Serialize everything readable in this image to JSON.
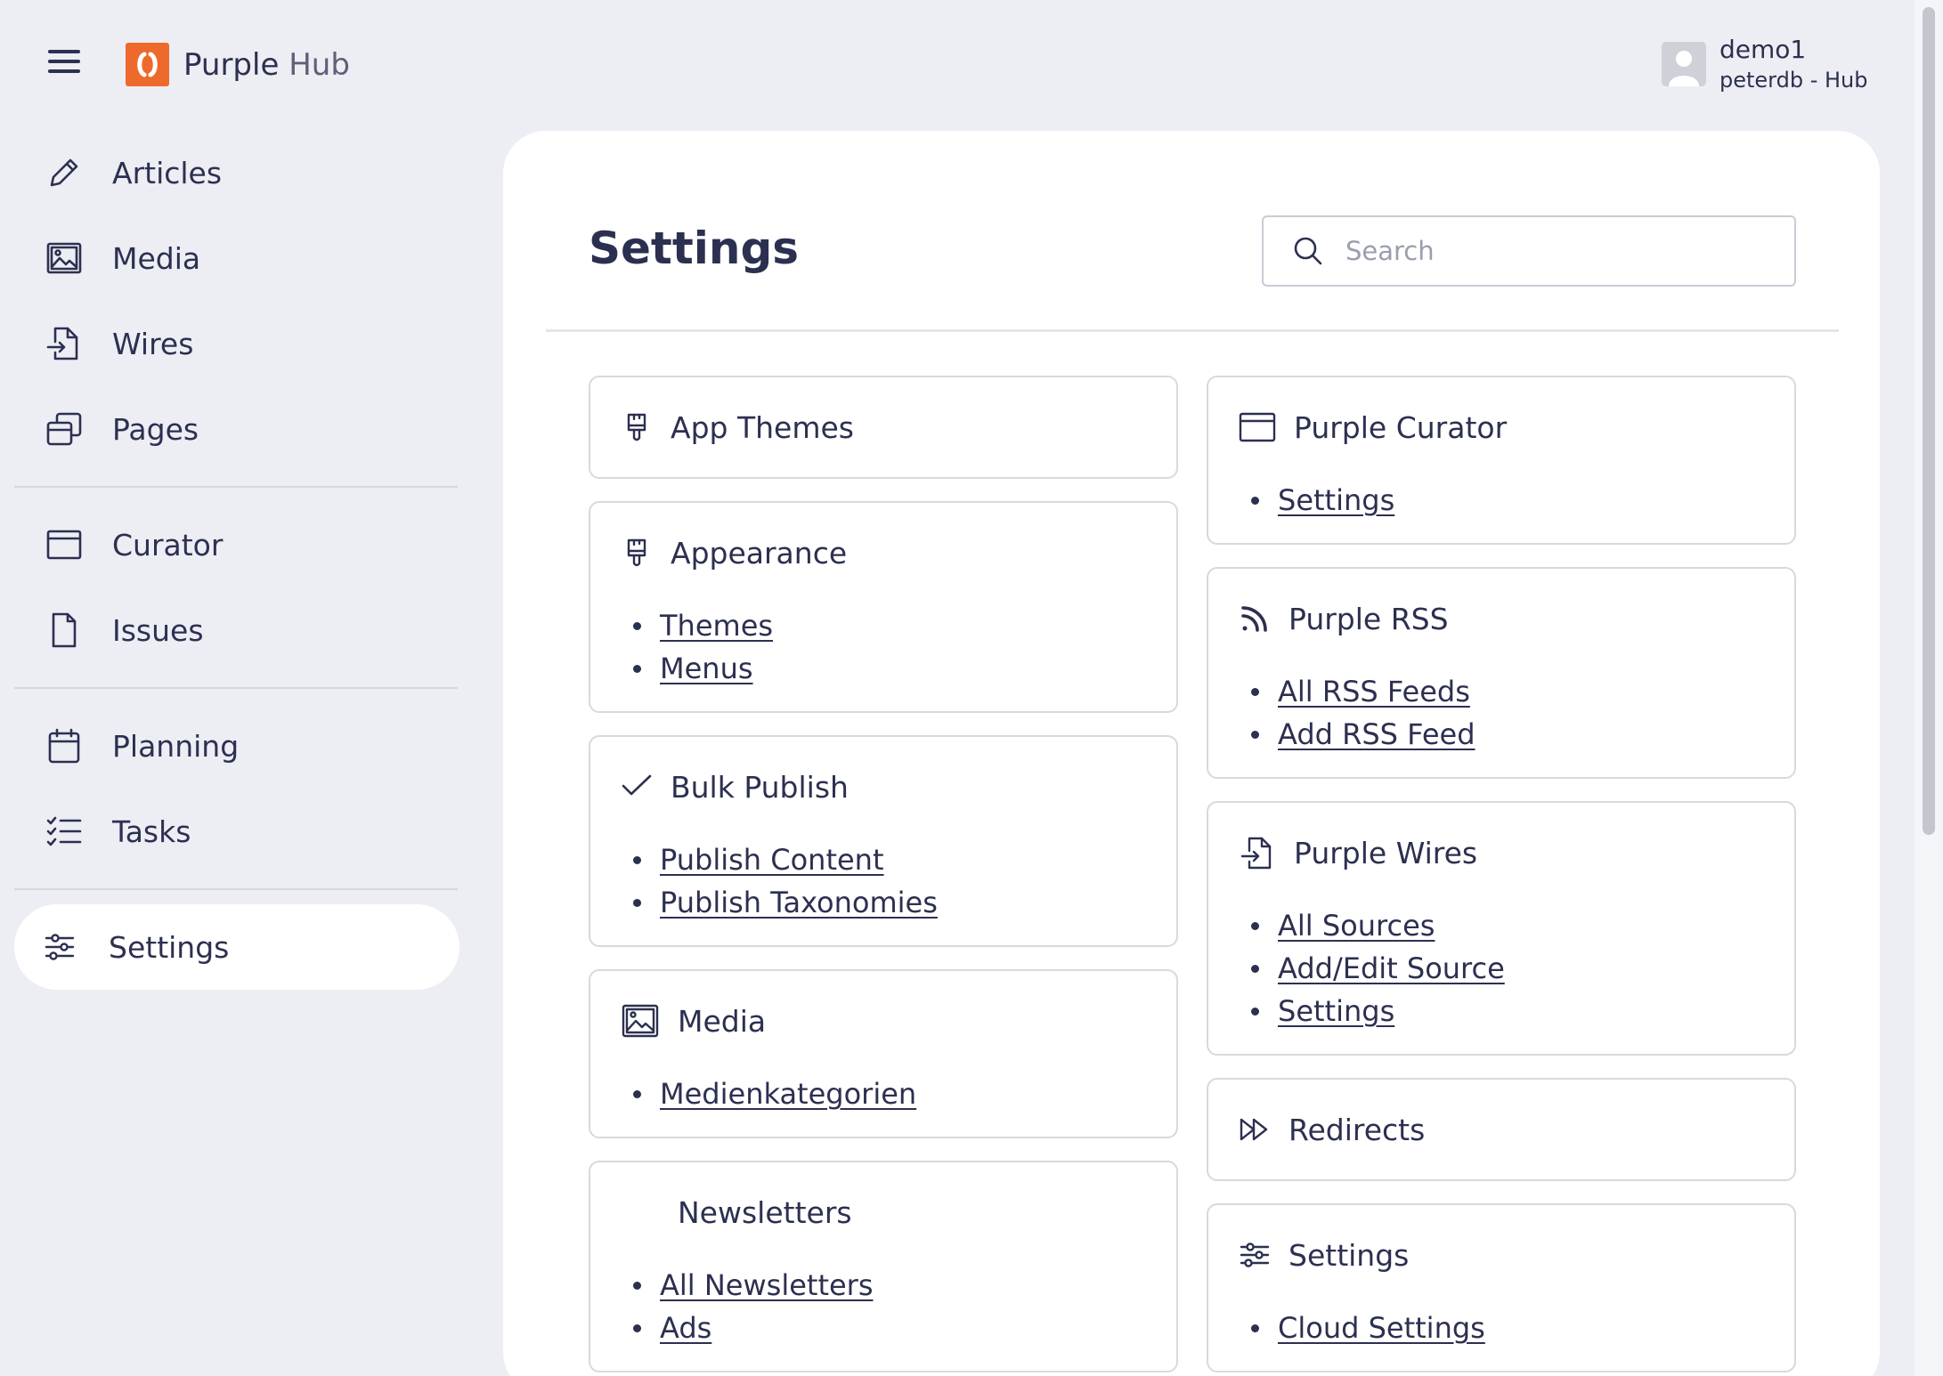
{
  "header": {
    "brand_main": "Purple",
    "brand_sub": "Hub",
    "user_name": "demo1",
    "user_sub": "peterdb - Hub"
  },
  "sidebar": {
    "group1": [
      {
        "label": "Articles",
        "icon": "pencil-icon"
      },
      {
        "label": "Media",
        "icon": "image-icon"
      },
      {
        "label": "Wires",
        "icon": "file-import-icon"
      },
      {
        "label": "Pages",
        "icon": "pages-icon"
      }
    ],
    "group2": [
      {
        "label": "Curator",
        "icon": "window-icon"
      },
      {
        "label": "Issues",
        "icon": "file-icon"
      }
    ],
    "group3": [
      {
        "label": "Planning",
        "icon": "calendar-icon"
      },
      {
        "label": "Tasks",
        "icon": "checklist-icon"
      }
    ],
    "active": {
      "label": "Settings",
      "icon": "sliders-icon"
    }
  },
  "main": {
    "title": "Settings",
    "search_placeholder": "Search"
  },
  "cards": {
    "app_themes": {
      "title": "App Themes"
    },
    "appearance": {
      "title": "Appearance",
      "links": [
        "Themes",
        "Menus"
      ]
    },
    "bulk_publish": {
      "title": "Bulk Publish",
      "links": [
        "Publish Content",
        "Publish Taxonomies"
      ]
    },
    "media": {
      "title": "Media",
      "links": [
        "Medienkategorien"
      ]
    },
    "newsletters": {
      "title": "Newsletters",
      "links": [
        "All Newsletters",
        "Ads"
      ]
    },
    "purple_curator": {
      "title": "Purple Curator",
      "links": [
        "Settings"
      ]
    },
    "purple_rss": {
      "title": "Purple RSS",
      "links": [
        "All RSS Feeds",
        "Add RSS Feed"
      ]
    },
    "purple_wires": {
      "title": "Purple Wires",
      "links": [
        "All Sources",
        "Add/Edit Source",
        "Settings"
      ]
    },
    "redirects": {
      "title": "Redirects"
    },
    "settings": {
      "title": "Settings",
      "links": [
        "Cloud Settings"
      ]
    }
  },
  "colors": {
    "background": "#eceef4",
    "text": "#2c3050",
    "brand": "#ee6a2c",
    "panel": "#ffffff"
  }
}
